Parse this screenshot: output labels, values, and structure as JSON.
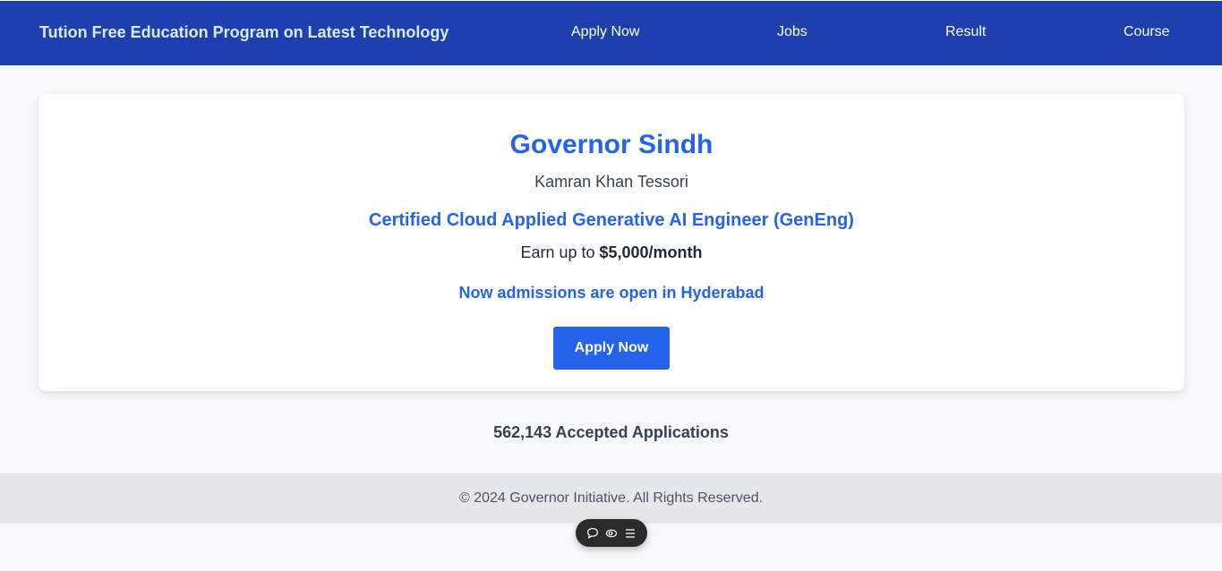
{
  "header": {
    "brand": "Tution Free Education Program on Latest Technology",
    "nav": {
      "apply": "Apply Now",
      "jobs": "Jobs",
      "result": "Result",
      "course": "Course"
    }
  },
  "card": {
    "title": "Governor Sindh",
    "subtitle": "Kamran Khan Tessori",
    "course": "Certified Cloud Applied Generative AI Engineer (GenEng)",
    "earn_prefix": "Earn up to ",
    "earn_amount": "$5,000/month",
    "admission": "Now admissions are open in Hyderabad",
    "apply_button": "Apply Now"
  },
  "stats": {
    "accepted": "562,143 Accepted Applications"
  },
  "footer": {
    "copyright": "© 2024 Governor Initiative. All Rights Reserved."
  },
  "toolbar": {
    "icons": [
      "comment-icon",
      "eye-icon",
      "menu-icon"
    ]
  },
  "colors": {
    "nav_bg": "#1e40af",
    "accent": "#2563eb",
    "footer_bg": "#e5e7eb",
    "page_bg": "#f8f9fb"
  }
}
